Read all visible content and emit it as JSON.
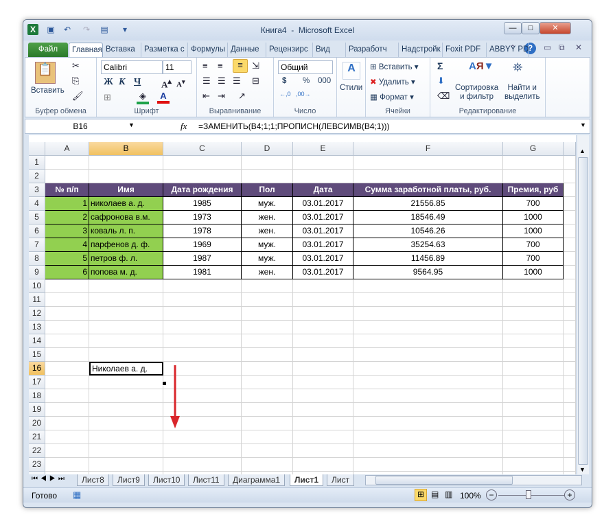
{
  "window": {
    "title": "Книга4  -  Microsoft Excel",
    "minimize": "—",
    "restore": "□",
    "close": "✕"
  },
  "ribbon_tabs": [
    "Файл",
    "Главная",
    "Вставка",
    "Разметка с",
    "Формулы",
    "Данные",
    "Рецензирс",
    "Вид",
    "Разработч",
    "Надстройк",
    "Foxit PDF",
    "ABBYY PDF"
  ],
  "active_tab": "Главная",
  "clipboard": {
    "paste": "Вставить",
    "label": "Буфер обмена"
  },
  "font": {
    "name": "Calibri",
    "size": "11",
    "bold": "Ж",
    "italic": "К",
    "underline": "Ч",
    "label": "Шрифт"
  },
  "alignment": {
    "label": "Выравнивание"
  },
  "number": {
    "format": "Общий",
    "currency": "$",
    "percent": "%",
    "thousands": "000",
    "label": "Число"
  },
  "styles": {
    "label": "Стили"
  },
  "cells": {
    "insert": "Вставить",
    "delete": "Удалить",
    "format": "Формат",
    "label": "Ячейки"
  },
  "editing": {
    "sum": "Σ",
    "sort": "Сортировка\nи фильтр",
    "find": "Найти и\nвыделить",
    "label": "Редактирование"
  },
  "formula_bar": {
    "name_box": "B16",
    "fx": "fx",
    "formula": "=ЗАМЕНИТЬ(B4;1;1;ПРОПИСН(ЛЕВСИМВ(B4;1)))"
  },
  "columns": [
    "A",
    "B",
    "C",
    "D",
    "E",
    "F",
    "G"
  ],
  "selected_cell": "B16",
  "table": {
    "headers": [
      "№ п/п",
      "Имя",
      "Дата рождения",
      "Пол",
      "Дата",
      "Сумма заработной платы, руб.",
      "Премия, руб"
    ],
    "rows": [
      [
        "1",
        "николаев а. д.",
        "1985",
        "муж.",
        "03.01.2017",
        "21556.85",
        "700"
      ],
      [
        "2",
        "сафронова в.м.",
        "1973",
        "жен.",
        "03.01.2017",
        "18546.49",
        "1000"
      ],
      [
        "3",
        "коваль л. п.",
        "1978",
        "жен.",
        "03.01.2017",
        "10546.26",
        "1000"
      ],
      [
        "4",
        "парфенов д. ф.",
        "1969",
        "муж.",
        "03.01.2017",
        "35254.63",
        "700"
      ],
      [
        "5",
        "петров ф. л.",
        "1987",
        "муж.",
        "03.01.2017",
        "11456.89",
        "700"
      ],
      [
        "6",
        "попова м. д.",
        "1981",
        "жен.",
        "03.01.2017",
        "9564.95",
        "1000"
      ]
    ]
  },
  "b16_value": "Николаев а. д.",
  "sheet_tabs": [
    "Лист8",
    "Лист9",
    "Лист10",
    "Лист11",
    "Диаграмма1",
    "Лист1",
    "Лист"
  ],
  "active_sheet": "Лист1",
  "status": {
    "ready": "Готово",
    "zoom": "100%"
  },
  "colors": {
    "header_fill": "#5f4b7b",
    "green_fill": "#92d050",
    "arrow": "#d9262b"
  }
}
